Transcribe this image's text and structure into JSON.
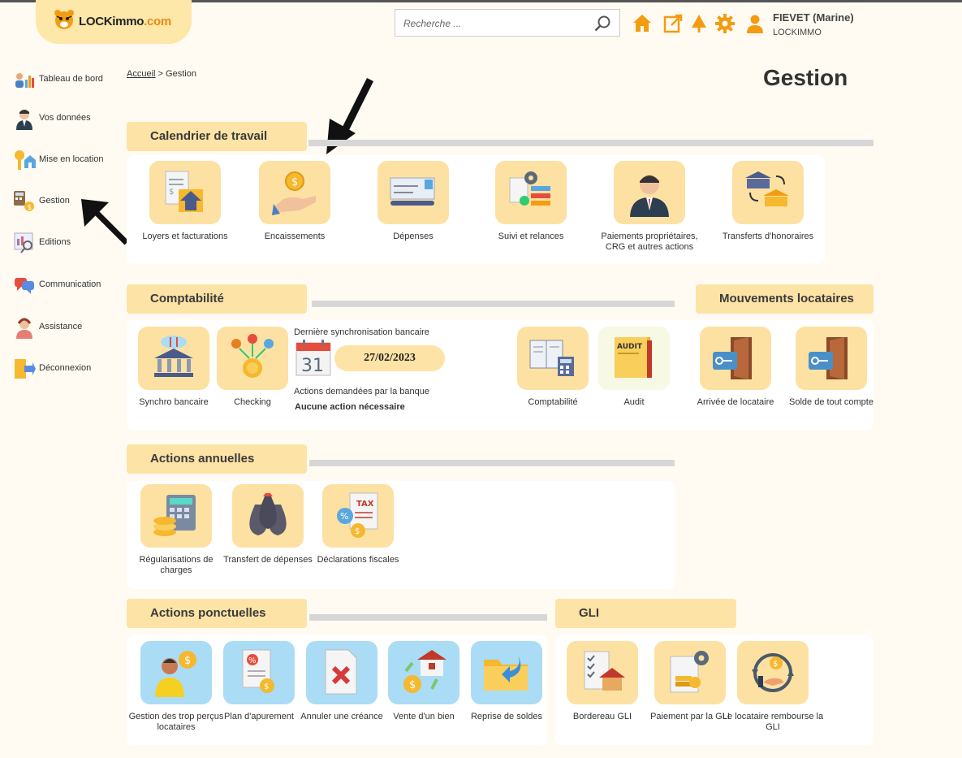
{
  "header": {
    "logo_text": "LOCKimmo",
    "logo_suffix": ".com",
    "search_placeholder": "Recherche ...",
    "user_name": "FIEVET (Marine)",
    "user_org": "LOCKIMMO"
  },
  "sidebar": {
    "items": [
      {
        "label": "Tableau de bord",
        "icon": "dashboard-chart-icon"
      },
      {
        "label": "Vos données",
        "icon": "user-profile-icon"
      },
      {
        "label": "Mise en location",
        "icon": "key-house-icon"
      },
      {
        "label": "Gestion",
        "icon": "calculator-coins-icon"
      },
      {
        "label": "Editions",
        "icon": "document-search-icon"
      },
      {
        "label": "Communication",
        "icon": "chat-bubbles-icon"
      },
      {
        "label": "Assistance",
        "icon": "support-agent-icon"
      },
      {
        "label": "Déconnexion",
        "icon": "logout-door-icon"
      }
    ]
  },
  "breadcrumb": {
    "home": "Accueil",
    "separator": ">",
    "current": "Gestion"
  },
  "page_title": "Gestion",
  "sections": {
    "calendrier": {
      "title": "Calendrier de travail",
      "tiles": [
        "Loyers et facturations",
        "Encaissements",
        "Dépenses",
        "Suivi et relances",
        "Paiements propriétaires, CRG et autres actions",
        "Transferts d'honoraires"
      ]
    },
    "comptabilite": {
      "title": "Comptabilité",
      "tiles": [
        "Synchro bancaire",
        "Checking",
        "Comptabilité",
        "Audit"
      ],
      "sync_label": "Dernière synchronisation bancaire",
      "calendar_day": "31",
      "sync_date": "27/02/2023",
      "actions_label": "Actions demandées par la banque",
      "actions_value": "Aucune action nécessaire"
    },
    "mouvements": {
      "title": "Mouvements locataires",
      "tiles": [
        "Arrivée de locataire",
        "Solde de tout compte"
      ]
    },
    "annuelles": {
      "title": "Actions annuelles",
      "tiles": [
        "Régularisations de charges",
        "Transfert de dépenses",
        "Déclarations fiscales"
      ]
    },
    "ponctuelles": {
      "title": "Actions ponctuelles",
      "tiles": [
        "Gestion des trop perçus locataires",
        "Plan d'apurement",
        "Annuler une créance",
        "Vente d'un bien",
        "Reprise de soldes"
      ]
    },
    "gli": {
      "title": "GLI",
      "tiles": [
        "Bordereau GLI",
        "Paiement par la GLI",
        "Le locataire rembourse la GLI"
      ]
    }
  },
  "audit_label": "AUDIT",
  "tax_label": "TAX",
  "colors": {
    "accent": "#fde3a6",
    "tile_orange": "#fde1a3",
    "tile_blue": "#aadcf5",
    "icon_orange": "#f39c12"
  }
}
